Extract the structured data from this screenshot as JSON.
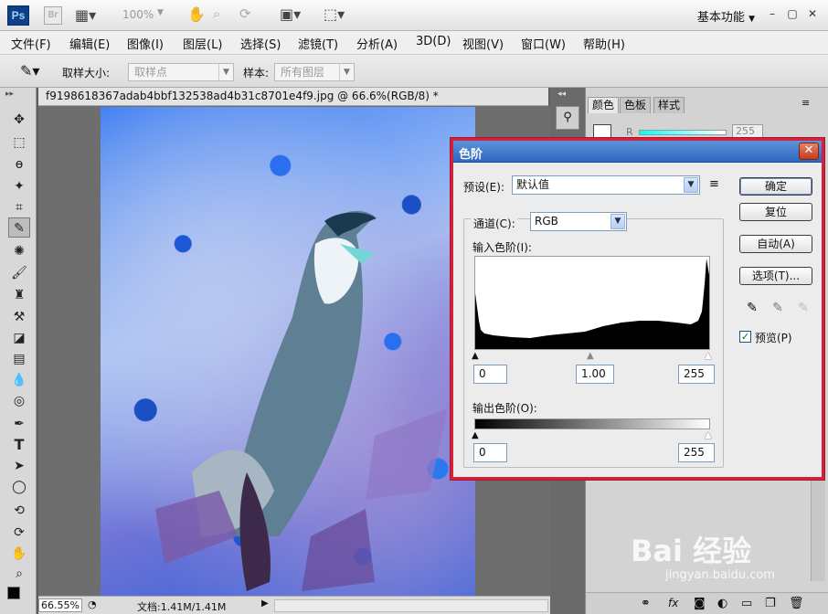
{
  "app": {
    "logo": "Ps",
    "bridge": "Br",
    "zoom": "100%",
    "workspace": "基本功能",
    "menu": [
      "文件(F)",
      "编辑(E)",
      "图像(I)",
      "图层(L)",
      "选择(S)",
      "滤镜(T)",
      "分析(A)",
      "3D(D)",
      "视图(V)",
      "窗口(W)",
      "帮助(H)"
    ]
  },
  "options": {
    "sample_size_label": "取样大小:",
    "sample_size_value": "取样点",
    "sample_label": "样本:",
    "sample_value": "所有图层"
  },
  "document": {
    "tab_title": "f9198618367adab4bbf132538ad4b31c8701e4f9.jpg @ 66.6%(RGB/8) *",
    "zoom": "66.55%",
    "doc_info": "文档:1.41M/1.41M"
  },
  "panel": {
    "tabs": [
      "颜色",
      "色板",
      "样式"
    ],
    "r_label": "R",
    "r_value": "255",
    "watermark": "Bai 经验",
    "watermark_url": "jingyan.baidu.com"
  },
  "dialog": {
    "title": "色阶",
    "preset_label": "预设(E):",
    "preset_value": "默认值",
    "channel_label": "通道(C):",
    "channel_value": "RGB",
    "input_levels_label": "输入色阶(I):",
    "input_black": "0",
    "input_gamma": "1.00",
    "input_white": "255",
    "output_levels_label": "输出色阶(O):",
    "output_black": "0",
    "output_white": "255",
    "buttons": {
      "ok": "确定",
      "reset": "复位",
      "auto": "自动(A)",
      "options": "选项(T)..."
    },
    "preview_label": "预览(P)",
    "preview_checked": true
  }
}
